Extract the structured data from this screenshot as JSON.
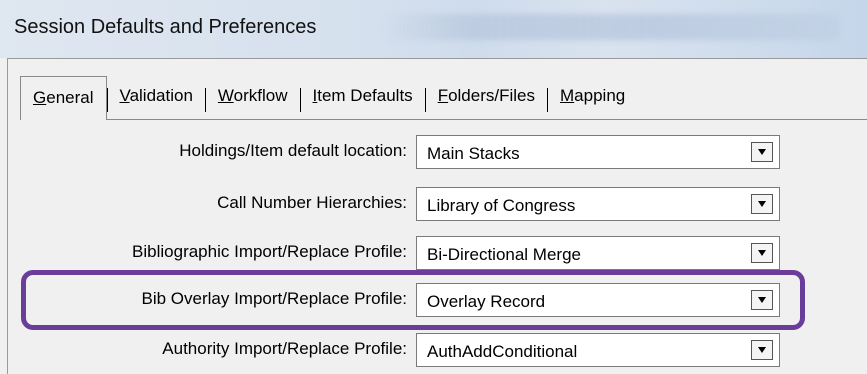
{
  "window": {
    "title": "Session Defaults and Preferences"
  },
  "tabs": [
    {
      "label_mnemonic": "G",
      "label_rest": "eneral",
      "active": true
    },
    {
      "label_mnemonic": "V",
      "label_rest": "alidation",
      "active": false
    },
    {
      "label_mnemonic": "W",
      "label_rest": "orkflow",
      "active": false
    },
    {
      "label_mnemonic": "I",
      "label_rest": "tem Defaults",
      "active": false
    },
    {
      "label_mnemonic": "F",
      "label_rest": "olders/Files",
      "active": false
    },
    {
      "label_mnemonic": "M",
      "label_rest": "apping",
      "active": false
    }
  ],
  "fields": [
    {
      "label": "Holdings/Item default location:",
      "value": "Main Stacks"
    },
    {
      "label": "Call Number Hierarchies:",
      "value": "Library of Congress"
    },
    {
      "label": "Bibliographic Import/Replace Profile:",
      "value": "Bi-Directional Merge"
    },
    {
      "label": "Bib Overlay Import/Replace Profile:",
      "value": "Overlay Record"
    },
    {
      "label": "Authority Import/Replace Profile:",
      "value": "AuthAddConditional"
    }
  ],
  "colors": {
    "highlight": "#6a3d9a"
  },
  "icons": {
    "dropdown": "dropdown-arrow-icon"
  }
}
